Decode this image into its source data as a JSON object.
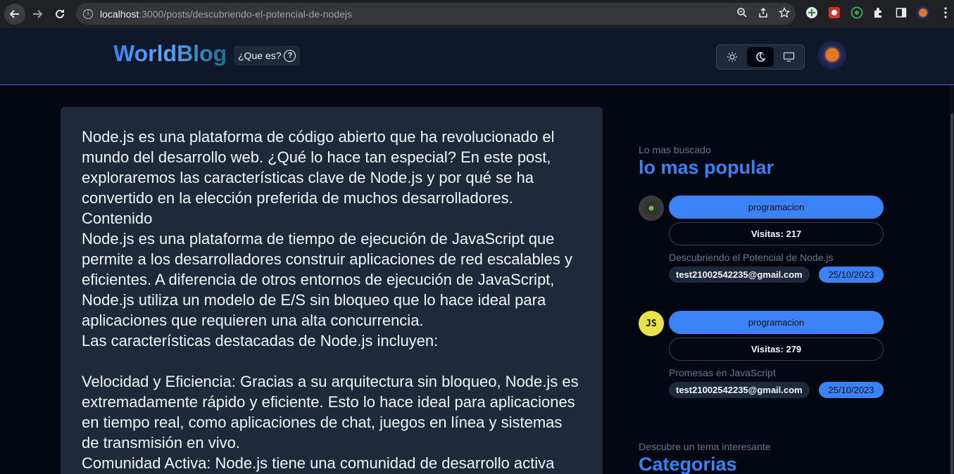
{
  "browser": {
    "url_host": "localhost",
    "url_path": ":3000/posts/descubriendo-el-potencial-de-nodejs",
    "info_icon": "info-icon",
    "actions": [
      "zoom-icon",
      "share-icon",
      "star-icon"
    ],
    "extensions": [
      "plus-circle-icon",
      "extension-red-icon",
      "extension-green-icon",
      "puzzle-icon",
      "sidebar-icon",
      "profile-avatar",
      "kebab-menu-icon"
    ]
  },
  "header": {
    "logo": "WorldBlog",
    "what_label": "¿Que es?",
    "theme_options": [
      "sun-icon",
      "moon-icon",
      "monitor-icon"
    ],
    "active_theme": "moon-icon",
    "colors": {
      "accent": "#3b82f6",
      "background": "#030712",
      "card": "#1e293b"
    }
  },
  "article": {
    "body": "Node.js es una plataforma de código abierto que ha revolucionado el mundo del desarrollo web. ¿Qué lo hace tan especial? En este post, exploraremos las características clave de Node.js y por qué se ha convertido en la elección preferida de muchos desarrolladores.\nContenido\nNode.js es una plataforma de tiempo de ejecución de JavaScript que permite a los desarrolladores construir aplicaciones de red escalables y eficientes. A diferencia de otros entornos de ejecución de JavaScript, Node.js utiliza un modelo de E/S sin bloqueo que lo hace ideal para aplicaciones que requieren una alta concurrencia.\nLas características destacadas de Node.js incluyen:\n\nVelocidad y Eficiencia: Gracias a su arquitectura sin bloqueo, Node.js es extremadamente rápido y eficiente. Esto lo hace ideal para aplicaciones en tiempo real, como aplicaciones de chat, juegos en línea y sistemas de transmisión en vivo.\nComunidad Activa: Node.js tiene una comunidad de desarrollo activa"
  },
  "sidebar": {
    "popular": {
      "eyebrow": "Lo mas buscado",
      "title": "lo mas popular",
      "posts": [
        {
          "tag": "programacion",
          "visits": "Visitas: 217",
          "title": "Descubriendo el Potencial de Node.js",
          "author": "test21002542235@gmail.com",
          "date": "25/10/2023",
          "thumb": "audio-wave-thumbnail"
        },
        {
          "tag": "programacion",
          "visits": "Visitas: 279",
          "title": "Promesas en JavaScript",
          "author": "test21002542235@gmail.com",
          "date": "25/10/2023",
          "thumb": "js-logo-thumbnail",
          "thumb_text": "JS"
        }
      ]
    },
    "categories": {
      "eyebrow": "Descubre un tema interesante",
      "title": "Categorias"
    }
  }
}
